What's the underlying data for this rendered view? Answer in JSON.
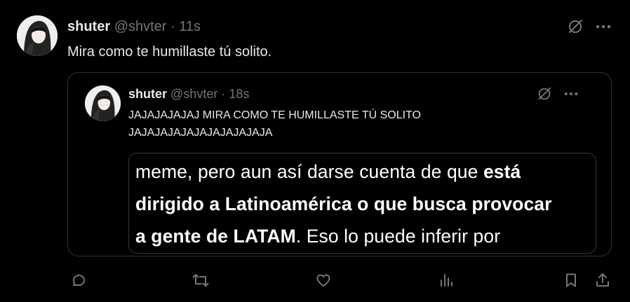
{
  "post": {
    "display_name": "shuter",
    "handle": "@shvter",
    "separator": "·",
    "time": "11s",
    "text": "Mira como te humillaste tú solito."
  },
  "quoted_post": {
    "display_name": "shuter",
    "handle": "@shvter",
    "separator": "·",
    "time": "18s",
    "text": "JAJAJAJAJAJ MIRA COMO TE HUMILLASTE TÚ SOLITO JAJAJAJAJAJAJAJAJAJAJA",
    "media": {
      "line1_regular": "meme, pero aun así darse cuenta de que ",
      "line1_bold": "está",
      "line2_bold": "dirigido a Latinoamérica o que busca provocar",
      "line3_bold": "a gente de LATAM",
      "line3_regular": ". Eso lo puede inferir por"
    }
  },
  "icons": {
    "grok": "grok-icon",
    "more": "more-icon",
    "reply": "reply-icon",
    "repost": "repost-icon",
    "like": "like-icon",
    "views": "views-icon",
    "bookmark": "bookmark-icon",
    "share": "share-icon"
  },
  "colors": {
    "background": "#000000",
    "text": "#e7e9ea",
    "secondary": "#71767b",
    "border": "#2f3336"
  }
}
